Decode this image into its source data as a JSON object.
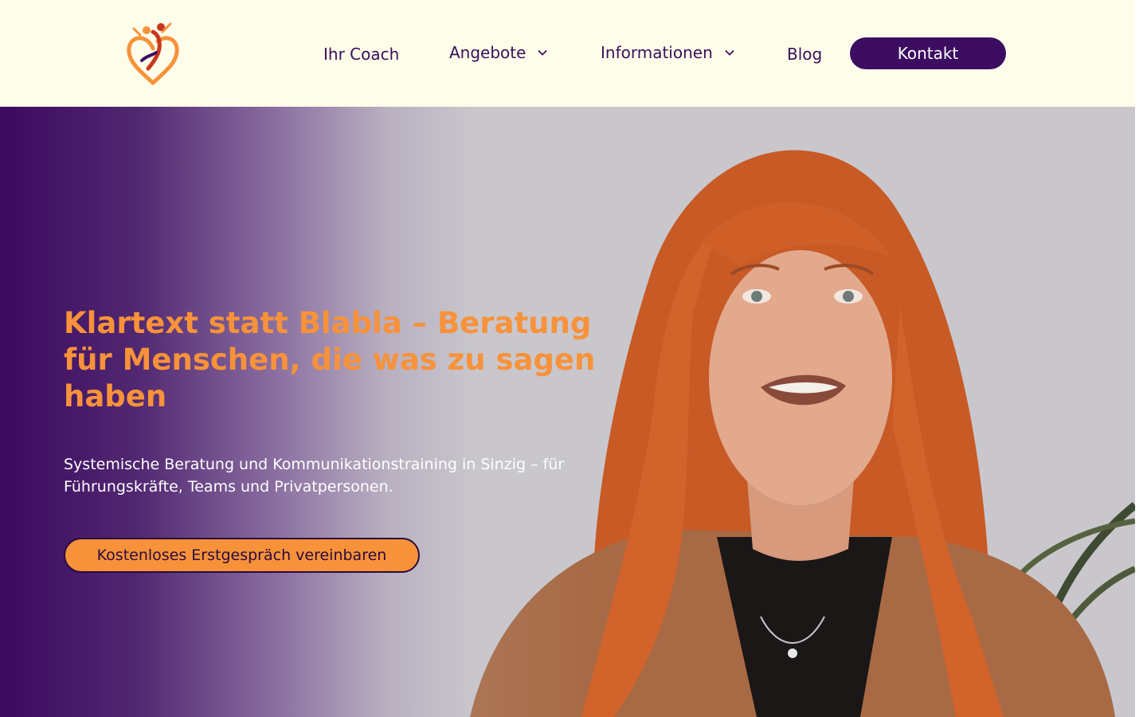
{
  "colors": {
    "header_bg": "#fefde9",
    "brand_purple": "#3c0d61",
    "accent_orange": "#f7923a",
    "nav_text": "#3a0f5c"
  },
  "header": {
    "logo_icon": "heart-figures-logo-icon",
    "nav": [
      {
        "label": "Ihr Coach",
        "has_dropdown": false
      },
      {
        "label": "Angebote",
        "has_dropdown": true
      },
      {
        "label": "Informationen",
        "has_dropdown": true
      },
      {
        "label": "Blog",
        "has_dropdown": false
      }
    ],
    "cta_label": "Kontakt"
  },
  "hero": {
    "title": "Klartext statt Blabla – Beratung für Menschen, die was zu sagen haben",
    "subtitle": "Systemische Beratung und Kommunikationstraining in Sinzig – für Führungskräfte, Teams und Privatpersonen.",
    "cta_label": "Kostenloses Erstgespräch vereinbaren",
    "photo_icon": "portrait-photo"
  }
}
